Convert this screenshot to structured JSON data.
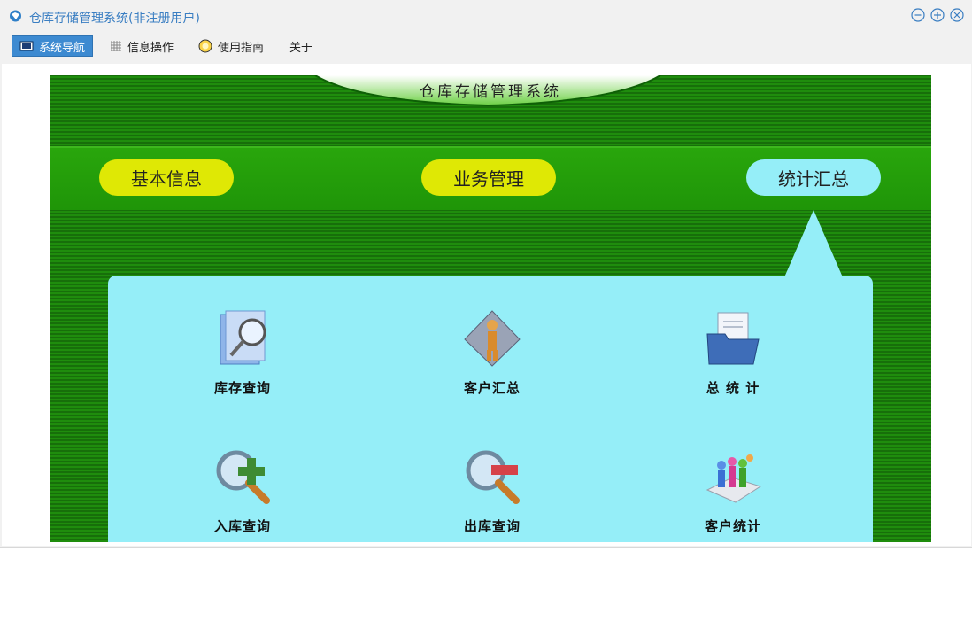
{
  "window": {
    "title": "仓库存储管理系统(非注册用户)",
    "controls": [
      "minimize-icon",
      "maximize-icon",
      "close-icon"
    ]
  },
  "menu": {
    "items": [
      {
        "label": "系统导航",
        "icon": "monitor-icon",
        "active": true
      },
      {
        "label": "信息操作",
        "icon": "grid-icon",
        "active": false
      },
      {
        "label": "使用指南",
        "icon": "lightbulb-icon",
        "active": false
      },
      {
        "label": "关于",
        "active": false
      }
    ]
  },
  "banner": {
    "title": "仓库存储管理系统"
  },
  "nav": {
    "items": [
      {
        "label": "基本信息",
        "color": "#dfe805"
      },
      {
        "label": "业务管理",
        "color": "#dfe805"
      },
      {
        "label": "统计汇总",
        "color": "#95eef8",
        "selected": true
      }
    ]
  },
  "panel": {
    "tiles": [
      {
        "label": "库存查询",
        "icon": "book-search-icon"
      },
      {
        "label": "客户汇总",
        "icon": "person-document-icon"
      },
      {
        "label": "总 统 计",
        "icon": "folder-documents-icon"
      },
      {
        "label": "入库查询",
        "icon": "magnifier-plus-icon"
      },
      {
        "label": "出库查询",
        "icon": "magnifier-minus-icon"
      },
      {
        "label": "客户统计",
        "icon": "people-chart-icon"
      }
    ]
  },
  "colors": {
    "accent": "#3d8ad1",
    "stage_green": "#1f8d0d",
    "panel_cyan": "#95eef8",
    "button_yellow": "#dfe805"
  }
}
